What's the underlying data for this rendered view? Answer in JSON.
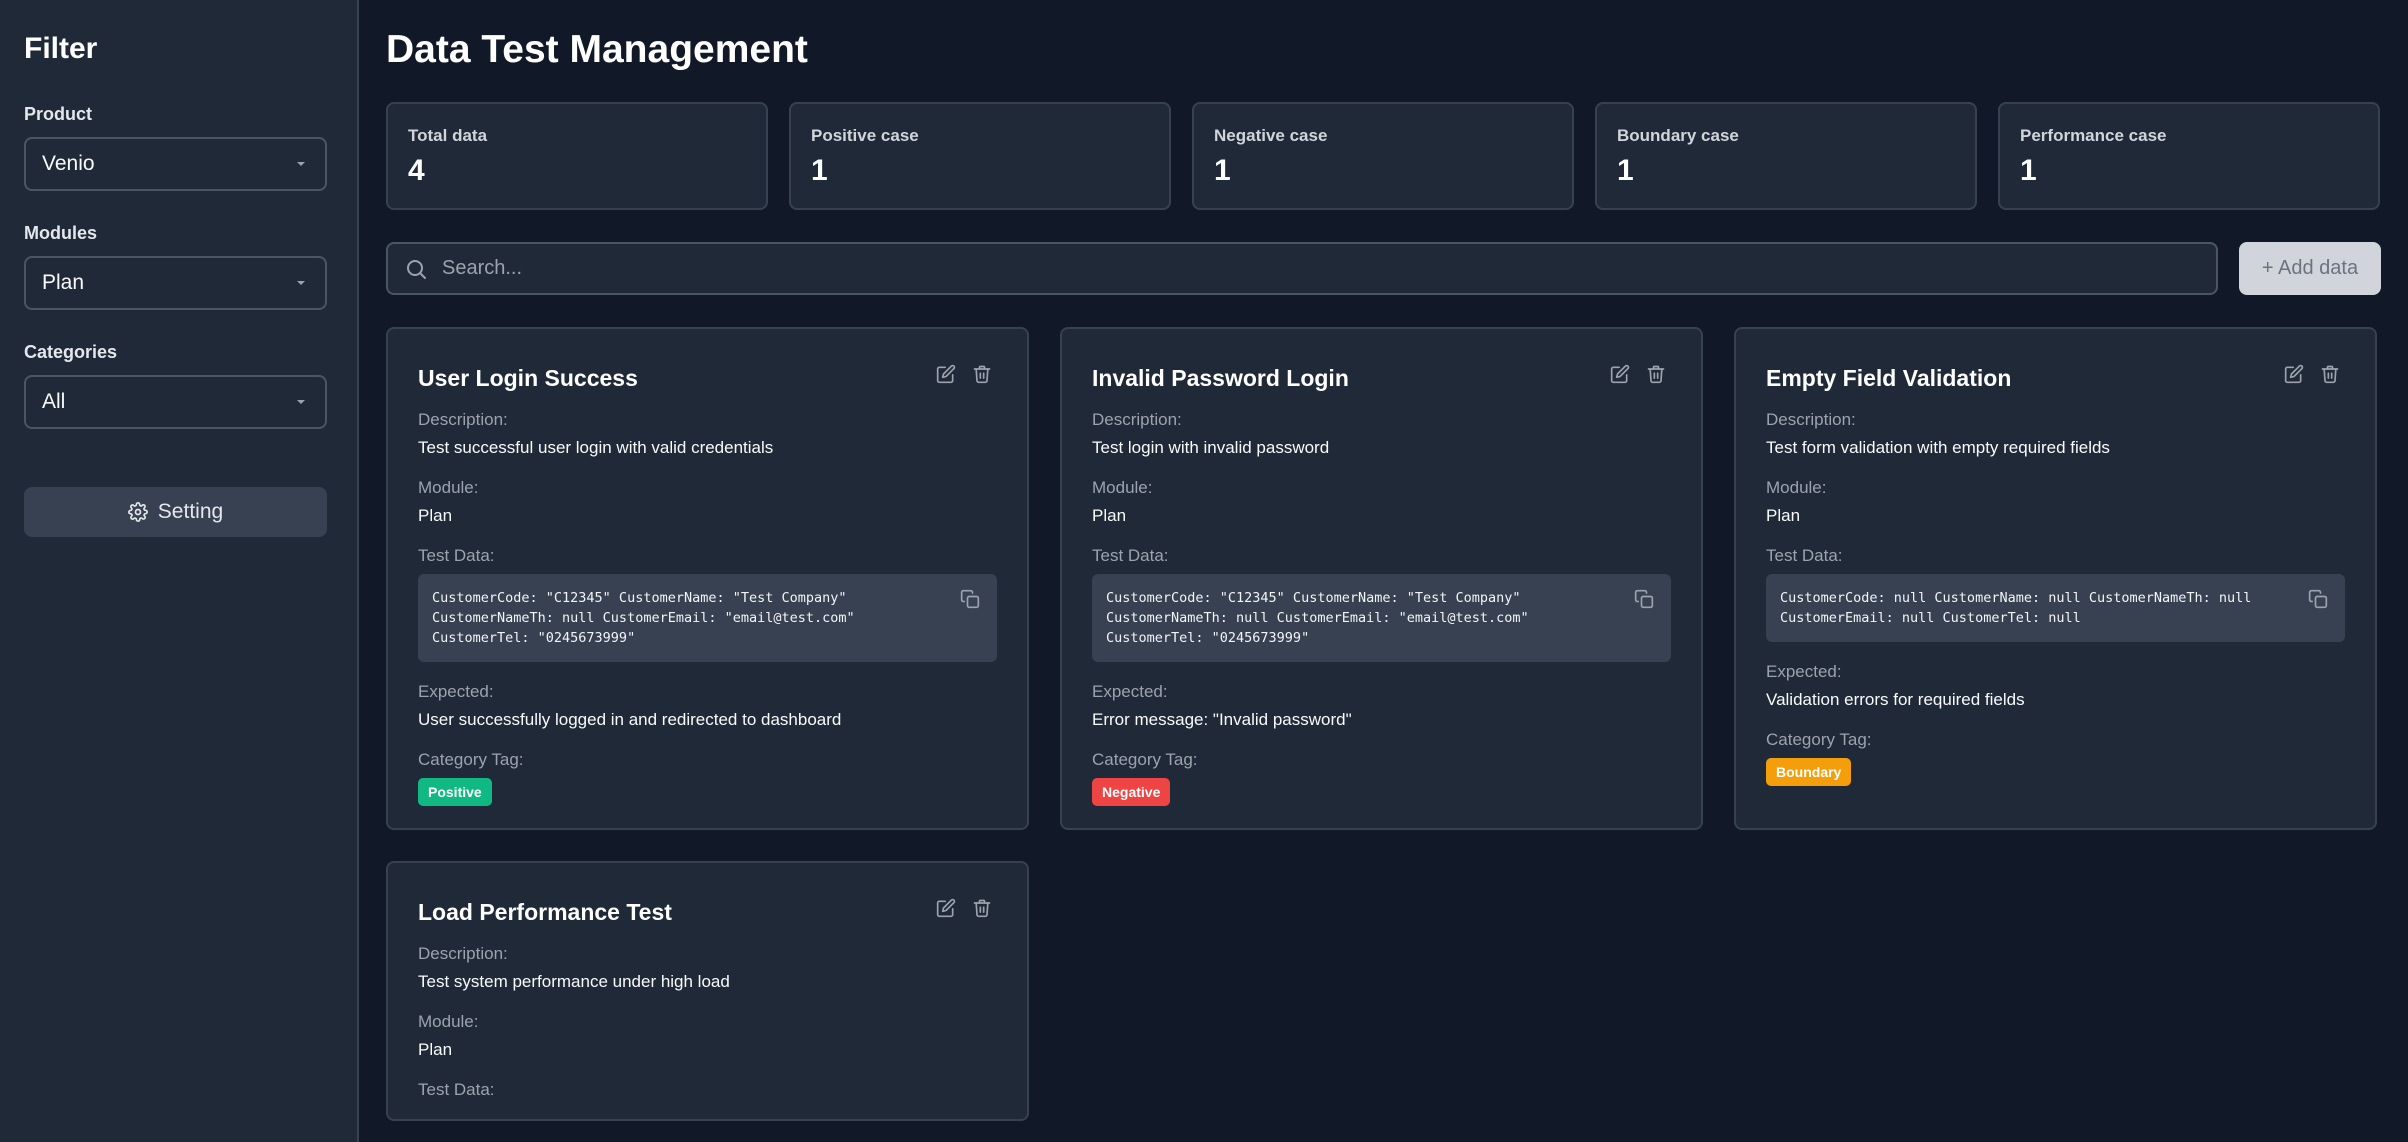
{
  "sidebar": {
    "title": "Filter",
    "product_label": "Product",
    "product_value": "Venio",
    "modules_label": "Modules",
    "modules_value": "Plan",
    "categories_label": "Categories",
    "categories_value": "All",
    "setting_label": "Setting"
  },
  "main": {
    "title": "Data Test Management",
    "stats": [
      {
        "label": "Total data",
        "value": "4"
      },
      {
        "label": "Positive case",
        "value": "1"
      },
      {
        "label": "Negative case",
        "value": "1"
      },
      {
        "label": "Boundary case",
        "value": "1"
      },
      {
        "label": "Performance case",
        "value": "1"
      }
    ],
    "search_placeholder": "Search...",
    "add_label": "+ Add data"
  },
  "card_labels": {
    "description": "Description:",
    "module": "Module:",
    "test_data": "Test Data:",
    "expected": "Expected:",
    "category_tag": "Category Tag:"
  },
  "cards": [
    {
      "title": "User Login Success",
      "description": "Test successful user login with valid credentials",
      "module": "Plan",
      "test_data": "CustomerCode: \"C12345\" CustomerName: \"Test Company\" CustomerNameTh: null CustomerEmail: \"email@test.com\" CustomerTel: \"0245673999\"",
      "expected": "User successfully logged in and redirected to dashboard",
      "tag": "Positive",
      "tag_color": "#10b981"
    },
    {
      "title": "Invalid Password Login",
      "description": "Test login with invalid password",
      "module": "Plan",
      "test_data": "CustomerCode: \"C12345\" CustomerName: \"Test Company\" CustomerNameTh: null CustomerEmail: \"email@test.com\" CustomerTel: \"0245673999\"",
      "expected": "Error message: \"Invalid password\"",
      "tag": "Negative",
      "tag_color": "#ef4444"
    },
    {
      "title": "Empty Field Validation",
      "description": "Test form validation with empty required fields",
      "module": "Plan",
      "test_data": "CustomerCode: null CustomerName: null CustomerNameTh: null CustomerEmail: null CustomerTel: null",
      "expected": "Validation errors for required fields",
      "tag": "Boundary",
      "tag_color": "#f59e0b"
    },
    {
      "title": "Load Performance Test",
      "description": "Test system performance under high load",
      "module": "Plan"
    }
  ]
}
